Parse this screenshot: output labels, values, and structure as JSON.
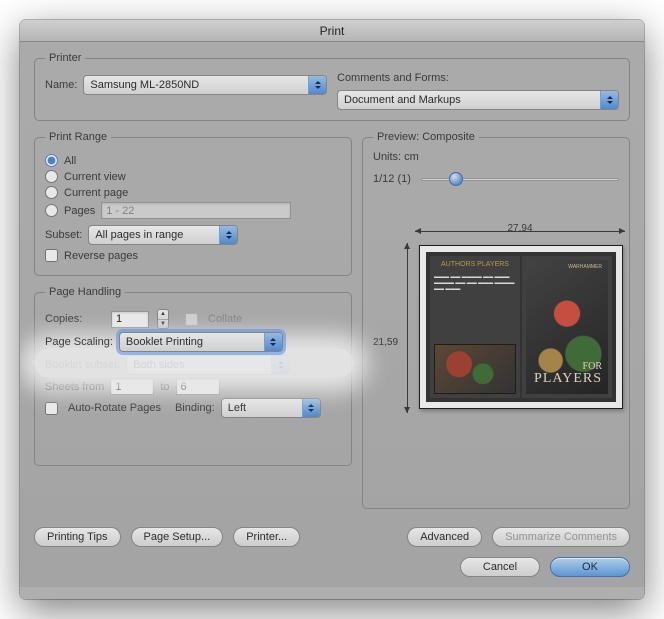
{
  "title": "Print",
  "printer": {
    "legend": "Printer",
    "name_label": "Name:",
    "name_value": "Samsung ML-2850ND",
    "comments_label": "Comments and Forms:",
    "comments_value": "Document and Markups"
  },
  "range": {
    "legend": "Print Range",
    "all": "All",
    "current_view": "Current view",
    "current_page": "Current page",
    "pages": "Pages",
    "pages_value": "1 - 22",
    "subset_label": "Subset:",
    "subset_value": "All pages in range",
    "reverse": "Reverse pages"
  },
  "handling": {
    "legend": "Page Handling",
    "copies_label": "Copies:",
    "copies_value": "1",
    "collate": "Collate",
    "scaling_label": "Page Scaling:",
    "scaling_value": "Booklet Printing",
    "booklet_subset_label": "Booklet subset:",
    "booklet_subset_value": "Both sides",
    "sheets_from": "Sheets from",
    "sheets_from_v": "1",
    "to": "to",
    "sheets_to_v": "6",
    "auto_rotate": "Auto-Rotate Pages",
    "binding_label": "Binding:",
    "binding_value": "Left"
  },
  "preview": {
    "legend": "Preview: Composite",
    "units": "Units: cm",
    "counter": "1/12 (1)",
    "width": "27,94",
    "height": "21,59",
    "pane1_hdr": "AUTHORS       PLAYERS",
    "pane2_l1": "FOR",
    "pane2_l2": "PLAYERS",
    "pane2_top": "WARHAMMER"
  },
  "buttons": {
    "tips": "Printing Tips",
    "page_setup": "Page Setup...",
    "printer": "Printer...",
    "advanced": "Advanced",
    "summarize": "Summarize Comments",
    "cancel": "Cancel",
    "ok": "OK"
  }
}
